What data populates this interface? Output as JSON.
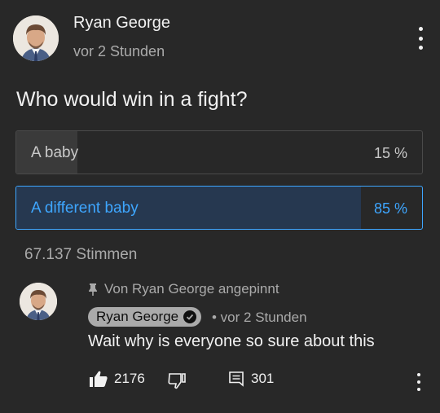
{
  "post": {
    "channel_name": "Ryan George",
    "time": "vor 2 Stunden",
    "question": "Who would win in a fight?",
    "options": [
      {
        "label": "A baby",
        "percent_label": "15 %",
        "percent": 15,
        "selected": false
      },
      {
        "label": "A different baby",
        "percent_label": "85 %",
        "percent": 85,
        "selected": true
      }
    ],
    "votes": "67.137 Stimmen"
  },
  "comment": {
    "pinned_label": "Von Ryan George angepinnt",
    "author": "Ryan George",
    "time": "• vor 2 Stunden",
    "text": "Wait why is everyone so sure about this",
    "likes": "2176",
    "replies": "301"
  },
  "colors": {
    "background": "#282828",
    "selected_accent": "#3ea6ff",
    "selected_fill": "#263850",
    "unselected_fill": "#3a3a3a",
    "muted_text": "#aaaaaa"
  },
  "icons": [
    "more-vert-icon",
    "pin-icon",
    "verified-check-icon",
    "thumbs-up-icon",
    "thumbs-down-icon",
    "reply-icon"
  ]
}
